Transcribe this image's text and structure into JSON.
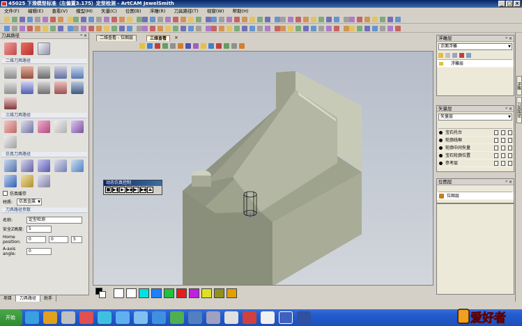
{
  "window": {
    "title": "45025 下滑模型标准（左偏置3.175）定型检测 - ArtCAM JewelSmith"
  },
  "menu": [
    "文件(F)",
    "编辑(E)",
    "查看(V)",
    "模型(M)",
    "矢量(C)",
    "位图(B)",
    "浮雕(R)",
    "刀具路径(T)",
    "视窗(W)",
    "帮助(H)"
  ],
  "left_panel": {
    "title": "刀具路径",
    "section_2d": "二维刀具路径",
    "section_3d": "三维刀具路径",
    "section_sim": "仿真刀具路径",
    "checkbox_label": "仿真缓存",
    "material_label": "材质:",
    "material_value": "仿真金属",
    "params_header": "刀具路径参数",
    "name_label": "名称:",
    "name_value": "定型检测",
    "safe_z_label": "安全Z高度:",
    "safe_z_value": "5",
    "home_label": "Home position:",
    "home_x": "0",
    "home_y": "0",
    "home_z": "5",
    "axis_label": "A-axis angle:",
    "axis_value": "0"
  },
  "left_tabs": [
    "项目",
    "刀具路径",
    "助手"
  ],
  "doc_tabs": [
    "二维查看 - 位图层",
    "三维查看"
  ],
  "sim_control": {
    "title": "动态仿真控制",
    "buttons": [
      "■",
      "▶▮",
      "▶",
      "▶▶",
      "▶|",
      "▶▶|",
      "⏏"
    ]
  },
  "palette_colors": [
    "#000000",
    "#ffffff",
    "#ffffff",
    "#00e0e0",
    "#2080ff",
    "#20c040",
    "#e02020",
    "#c020e0",
    "#e0e020",
    "#909020",
    "#e0a000"
  ],
  "layers_panel": {
    "title": "浮雕层",
    "dropdown": "正面浮雕",
    "row": "浮雕层"
  },
  "vector_panel": {
    "title": "矢量层",
    "dropdown": "矢量层",
    "rows": [
      "宝石托台",
      "轮廓线框",
      "轮廓中间矢量",
      "宝石轮廓位置",
      "参考层"
    ]
  },
  "bitmap_panel": {
    "title": "位图层",
    "row": "位图层"
  },
  "right_tabs": [
    "浮雕",
    "刀具路径"
  ],
  "taskbar": {
    "start": "开始"
  },
  "logo": {
    "text": "爱好者"
  },
  "colors": {
    "title_bar": "#0a246a",
    "viewport_bg": "#c2c8d1",
    "model_face": "#9aa08a"
  }
}
